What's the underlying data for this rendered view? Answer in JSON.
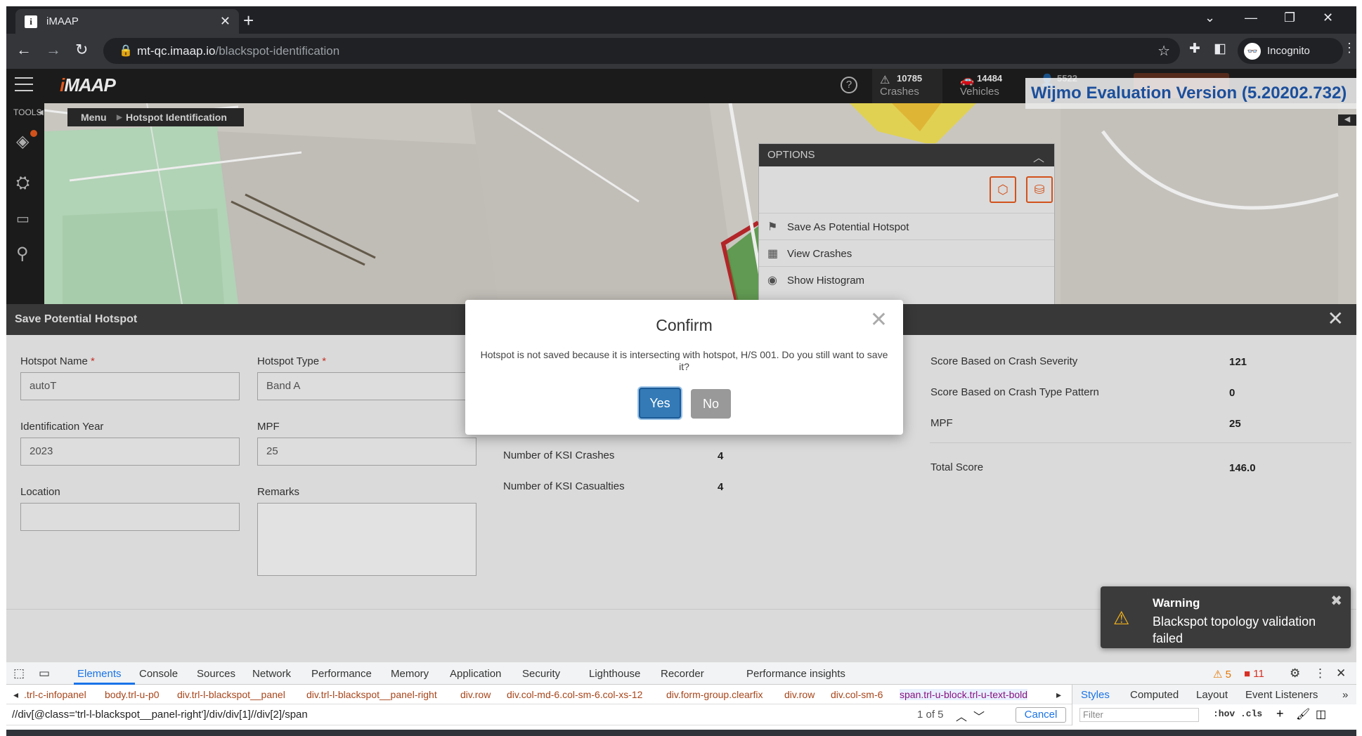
{
  "browser": {
    "tab_title": "iMAAP",
    "url_host": "mt-qc.imaap.io",
    "url_path": "/blackspot-identification",
    "incognito_label": "Incognito"
  },
  "app": {
    "logo": "iMAAP",
    "stats": [
      {
        "icon": "crash-icon",
        "value": "10785",
        "label": "Crashes"
      },
      {
        "icon": "vehicle-icon",
        "value": "14484",
        "label": "Vehicles"
      },
      {
        "icon": "person-icon",
        "value": "5522",
        "label": ""
      }
    ],
    "watermark": "Wijmo Evaluation Version (5.20202.732)",
    "tools_label": "TOOLS",
    "breadcrumb": [
      "Menu",
      "Hotspot Identification"
    ]
  },
  "options": {
    "title": "OPTIONS",
    "items": [
      "Save As Potential Hotspot",
      "View Crashes",
      "Show Histogram"
    ]
  },
  "panel": {
    "title": "Save Potential Hotspot",
    "fields": {
      "hotspot_name": {
        "label": "Hotspot Name",
        "value": "autoT"
      },
      "hotspot_type": {
        "label": "Hotspot Type",
        "value": "Band A"
      },
      "identification_year": {
        "label": "Identification Year",
        "value": "2023"
      },
      "mpf": {
        "label": "MPF",
        "value": "25"
      },
      "location": {
        "label": "Location",
        "value": ""
      },
      "remarks": {
        "label": "Remarks",
        "value": ""
      }
    },
    "ksi": [
      {
        "label": "Number of KSI Crashes",
        "value": "4"
      },
      {
        "label": "Number of KSI Casualties",
        "value": "4"
      }
    ],
    "scores": [
      {
        "label": "Score Based on Crash Severity",
        "value": "121"
      },
      {
        "label": "Score Based on Crash Type Pattern",
        "value": "0"
      },
      {
        "label": "MPF",
        "value": "25"
      }
    ],
    "total": {
      "label": "Total Score",
      "value": "146.0"
    },
    "required_marker": "*"
  },
  "modal": {
    "title": "Confirm",
    "message": "Hotspot is not saved because it is intersecting with hotspot, H/S 001. Do you still want to save it?",
    "yes": "Yes",
    "no": "No"
  },
  "toast": {
    "title": "Warning",
    "message": "Blackspot topology validation failed"
  },
  "devtools": {
    "tabs": [
      "Elements",
      "Console",
      "Sources",
      "Network",
      "Performance",
      "Memory",
      "Application",
      "Security",
      "Lighthouse",
      "Recorder",
      "Performance insights"
    ],
    "warnings": "5",
    "errors": "11",
    "crumbs": [
      ".trl-c-infopanel",
      "body.trl-u-p0",
      "div.trl-l-blackspot__panel",
      "div.trl-l-blackspot__panel-right",
      "div.row",
      "div.col-md-6.col-sm-6.col-xs-12",
      "div.form-group.clearfix",
      "div.row",
      "div.col-sm-6",
      "span.trl-u-block.trl-u-text-bold"
    ],
    "side_tabs": [
      "Styles",
      "Computed",
      "Layout",
      "Event Listeners"
    ],
    "xpath": "//div[@class='trl-l-blackspot__panel-right']/div/div[1]//div[2]/span",
    "match_count": "1 of 5",
    "cancel": "Cancel",
    "filter_placeholder": "Filter",
    "hov": ":hov .cls"
  },
  "colors": {
    "accent": "#e2591e",
    "primary_button": "#337ab7",
    "warning": "#f1b11b"
  }
}
